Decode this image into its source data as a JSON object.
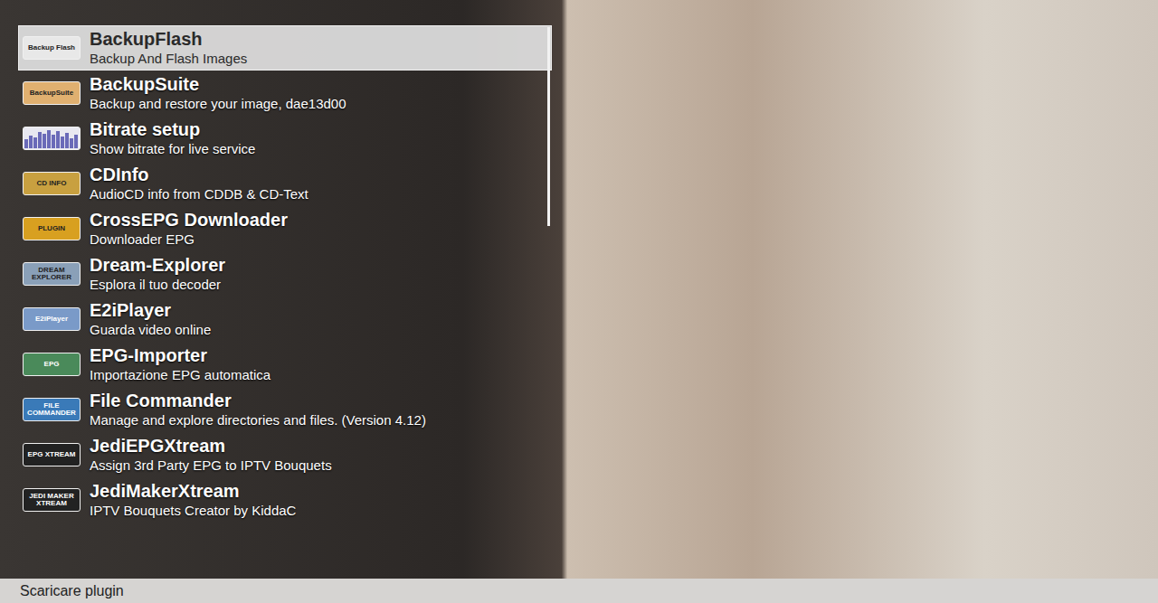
{
  "menu": {
    "items": [
      {
        "name": "BackupFlash",
        "description": "Backup And Flash Images",
        "selected": true,
        "kind": "label",
        "icon_text": "Backup Flash",
        "color": "#e8e8e8"
      },
      {
        "name": "BackupSuite",
        "description": "Backup and restore your image, dae13d00",
        "selected": false,
        "kind": "label",
        "icon_text": "BackupSuite",
        "color": "#e0b070"
      },
      {
        "name": "Bitrate setup",
        "description": "Show bitrate for live service",
        "selected": false,
        "kind": "bars",
        "icon_text": "",
        "color": "#6a6ab8"
      },
      {
        "name": "CDInfo",
        "description": "AudioCD info from CDDB & CD-Text",
        "selected": false,
        "kind": "label",
        "icon_text": "CD INFO",
        "color": "#c8a040"
      },
      {
        "name": "CrossEPG Downloader",
        "description": "Downloader EPG",
        "selected": false,
        "kind": "label",
        "icon_text": "PLUGIN",
        "color": "#d8a020"
      },
      {
        "name": "Dream-Explorer",
        "description": "Esplora il tuo decoder",
        "selected": false,
        "kind": "label",
        "icon_text": "DREAM EXPLORER",
        "color": "#8aa0b8"
      },
      {
        "name": "E2iPlayer",
        "description": "Guarda video online",
        "selected": false,
        "kind": "label",
        "icon_text": "E2iPlayer",
        "color": "#7a9ac8"
      },
      {
        "name": "EPG-Importer",
        "description": "Importazione EPG automatica",
        "selected": false,
        "kind": "label",
        "icon_text": "EPG",
        "color": "#4a8a5a"
      },
      {
        "name": "File Commander",
        "description": "Manage and explore directories and files. (Version 4.12)",
        "selected": false,
        "kind": "label",
        "icon_text": "FILE COMMANDER",
        "color": "#3a7ab8"
      },
      {
        "name": "JediEPGXtream",
        "description": "Assign 3rd Party EPG to IPTV Bouquets",
        "selected": false,
        "kind": "label",
        "icon_text": "EPG XTREAM",
        "color": "#222222"
      },
      {
        "name": "JediMakerXtream",
        "description": "IPTV Bouquets Creator by KiddaC",
        "selected": false,
        "kind": "label",
        "icon_text": "JEDI MAKER XTREAM",
        "color": "#222222"
      }
    ],
    "scrollbar": {
      "level": 0.36
    }
  },
  "status_bar": {
    "text": "Scaricare plugin"
  }
}
